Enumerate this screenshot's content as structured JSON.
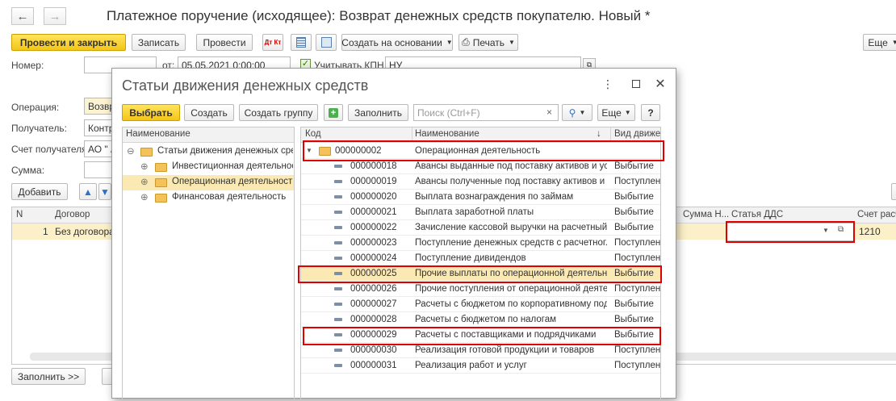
{
  "window": {
    "title": "Платежное поручение (исходящее): Возврат денежных средств покупателю. Новый *"
  },
  "toolbar": {
    "post_close": "Провести и закрыть",
    "save": "Записать",
    "post": "Провести",
    "dt_icon": "Дт Кт",
    "create_based": "Создать на основании",
    "print": "Печать",
    "more": "Еще"
  },
  "form": {
    "number_label": "Номер:",
    "from_label": "от:",
    "date_value": "05.05.2021  0:00:00",
    "kpn_label": "Учитывать КПН",
    "nu_value": "НУ",
    "operation_label": "Операция:",
    "operation_value": "Возвр",
    "recipient_label": "Получатель:",
    "recipient_value": "Контр",
    "account_label": "Счет получателя:",
    "account_value": "АО \" А",
    "sum_label": "Сумма:",
    "add_button": "Добавить",
    "fill_button": "Заполнить >>"
  },
  "table": {
    "headers": [
      "N",
      "Договор",
      "Сумма Н...",
      "Статья ДДС",
      "Счет расч"
    ],
    "row_n": "1",
    "row_contract": "Без договора",
    "row_account": "1210"
  },
  "dialog": {
    "title": "Статьи движения денежных средств",
    "select": "Выбрать",
    "create": "Создать",
    "create_group": "Создать группу",
    "fill": "Заполнить",
    "search_placeholder": "Поиск (Ctrl+F)",
    "more": "Еще",
    "help": "?",
    "tree_header": "Наименование",
    "tree": {
      "root": "Статьи движения денежных средств",
      "children": [
        "Инвестиционная деятельность",
        "Операционная деятельность",
        "Финансовая деятельность"
      ]
    },
    "list_headers": {
      "code": "Код",
      "name": "Наименование",
      "sort": "↓",
      "kind": "Вид движения"
    },
    "group_row": {
      "code": "000000002",
      "name": "Операционная деятельность"
    },
    "rows": [
      {
        "code": "000000018",
        "name": "Авансы выданные под поставку активов и ус...",
        "kind": "Выбытие"
      },
      {
        "code": "000000019",
        "name": "Авансы полученные под поставку активов и ...",
        "kind": "Поступление"
      },
      {
        "code": "000000020",
        "name": "Выплата вознаграждения по займам",
        "kind": "Выбытие"
      },
      {
        "code": "000000021",
        "name": "Выплата заработной платы",
        "kind": "Выбытие"
      },
      {
        "code": "000000022",
        "name": "Зачисление кассовой выручки на расчетный ...",
        "kind": "Выбытие"
      },
      {
        "code": "000000023",
        "name": "Поступление денежных средств с расчетног...",
        "kind": "Поступление"
      },
      {
        "code": "000000024",
        "name": "Поступление дивидендов",
        "kind": "Поступление"
      },
      {
        "code": "000000025",
        "name": "Прочие выплаты по операционной деятельно...",
        "kind": "Выбытие"
      },
      {
        "code": "000000026",
        "name": "Прочие поступления от операционной деятель...",
        "kind": "Поступление"
      },
      {
        "code": "000000027",
        "name": "Расчеты с бюджетом по корпоративному под...",
        "kind": "Выбытие"
      },
      {
        "code": "000000028",
        "name": "Расчеты с бюджетом по налогам",
        "kind": "Выбытие"
      },
      {
        "code": "000000029",
        "name": "Расчеты с поставщиками и подрядчиками",
        "kind": "Выбытие"
      },
      {
        "code": "000000030",
        "name": "Реализация готовой продукции и товаров",
        "kind": "Поступление"
      },
      {
        "code": "000000031",
        "name": "Реализация работ и услуг",
        "kind": "Поступление"
      }
    ]
  },
  "colors": {
    "accent_yellow": "#f5c518",
    "highlight_red": "#e00000",
    "selected_row": "#fbe9b3"
  }
}
